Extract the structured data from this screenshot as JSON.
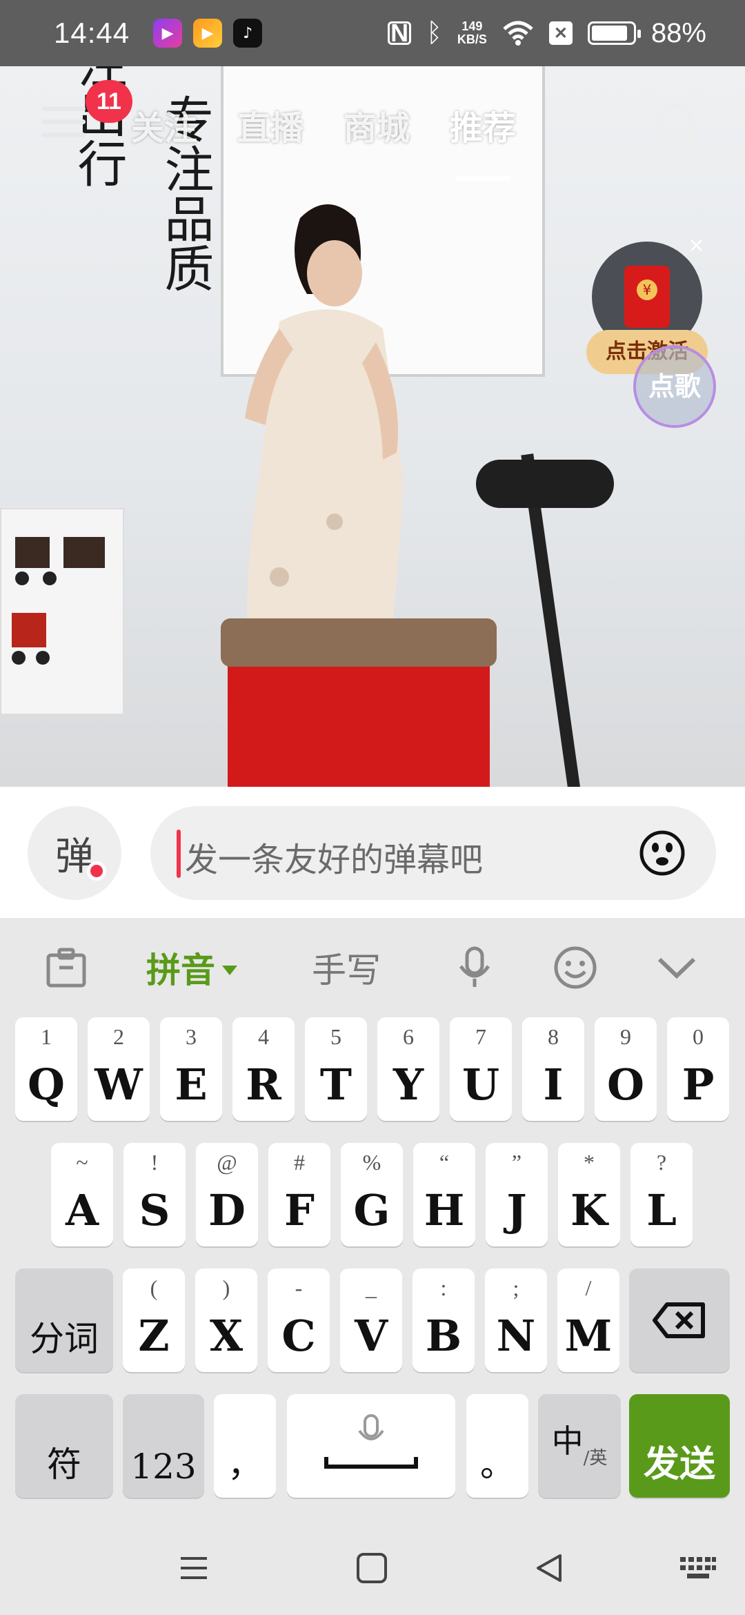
{
  "status_bar": {
    "time": "14:44",
    "net_speed_value": "149",
    "net_speed_unit": "KB/S",
    "battery": "88%",
    "battery_level": 0.88,
    "app_icons": [
      "video-app-icon",
      "pan-app-icon",
      "tiktok-icon"
    ]
  },
  "top_nav": {
    "badge_count": "11",
    "tabs": [
      {
        "label": "关注"
      },
      {
        "label": "直播"
      },
      {
        "label": "商城"
      },
      {
        "label": "推荐"
      }
    ],
    "active_tab": "推荐"
  },
  "video": {
    "calligraphy_left": "注出行",
    "calligraphy_center": "专注品质"
  },
  "promo": {
    "label": "点击激活",
    "song_button": "点歌"
  },
  "danmaku": {
    "toggle_label": "弹",
    "placeholder": "发一条友好的弹幕吧"
  },
  "keyboard": {
    "toolbar": {
      "pinyin": "拼音",
      "handwriting": "手写"
    },
    "row1": [
      {
        "hint": "1",
        "key": "Q"
      },
      {
        "hint": "2",
        "key": "W"
      },
      {
        "hint": "3",
        "key": "E"
      },
      {
        "hint": "4",
        "key": "R"
      },
      {
        "hint": "5",
        "key": "T"
      },
      {
        "hint": "6",
        "key": "Y"
      },
      {
        "hint": "7",
        "key": "U"
      },
      {
        "hint": "8",
        "key": "I"
      },
      {
        "hint": "9",
        "key": "O"
      },
      {
        "hint": "0",
        "key": "P"
      }
    ],
    "row2": [
      {
        "hint": "~",
        "key": "A"
      },
      {
        "hint": "!",
        "key": "S"
      },
      {
        "hint": "@",
        "key": "D"
      },
      {
        "hint": "#",
        "key": "F"
      },
      {
        "hint": "%",
        "key": "G"
      },
      {
        "hint": "“",
        "key": "H"
      },
      {
        "hint": "”",
        "key": "J"
      },
      {
        "hint": "*",
        "key": "K"
      },
      {
        "hint": "?",
        "key": "L"
      }
    ],
    "row3": [
      {
        "hint": "(",
        "key": "Z"
      },
      {
        "hint": ")",
        "key": "X"
      },
      {
        "hint": "-",
        "key": "C"
      },
      {
        "hint": "_",
        "key": "V"
      },
      {
        "hint": ":",
        "key": "B"
      },
      {
        "hint": ";",
        "key": "N"
      },
      {
        "hint": "/",
        "key": "M"
      }
    ],
    "segment": "分词",
    "symbols": "符",
    "numbers": "123",
    "comma": "，",
    "period": "。",
    "lang_main": "中",
    "lang_sub": "/英",
    "send": "发送"
  }
}
